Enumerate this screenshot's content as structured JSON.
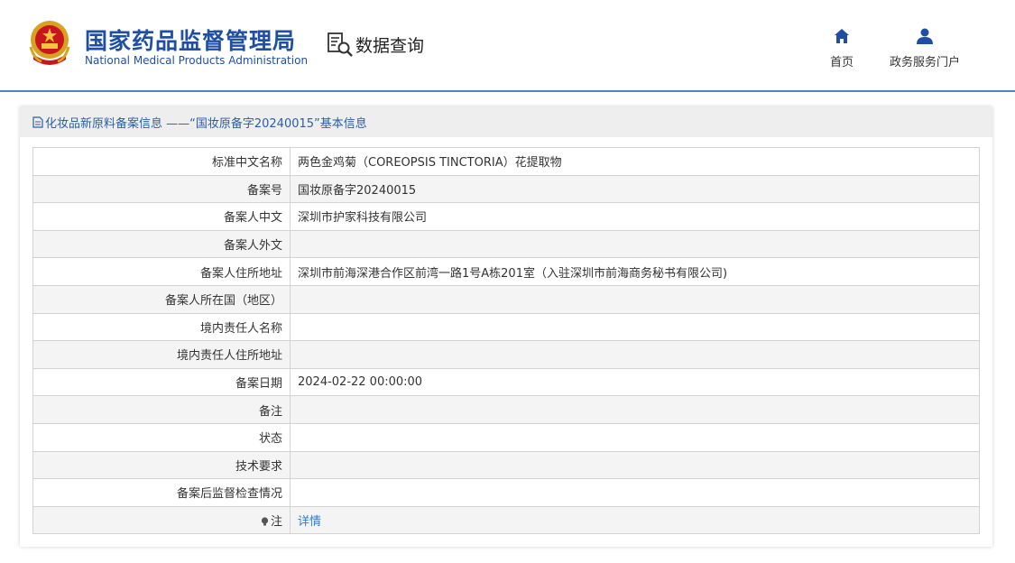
{
  "header": {
    "org_cn": "国家药品监督管理局",
    "org_en": "National Medical Products Administration",
    "data_query": "数据查询",
    "nav": [
      {
        "label": "首页",
        "icon": "home-icon"
      },
      {
        "label": "政务服务门户",
        "icon": "user-icon"
      }
    ]
  },
  "colors": {
    "brand": "#1f4fa3",
    "accent_line": "#4a86c6",
    "link": "#2b7bd6"
  },
  "panel": {
    "title": "化妆品新原料备案信息 ——“国妆原备字20240015”基本信息",
    "rows": [
      {
        "label": "标准中文名称",
        "value": "两色金鸡菊（COREOPSIS TINCTORIA）花提取物"
      },
      {
        "label": "备案号",
        "value": "国妆原备字20240015"
      },
      {
        "label": "备案人中文",
        "value": "深圳市护家科技有限公司"
      },
      {
        "label": "备案人外文",
        "value": ""
      },
      {
        "label": "备案人住所地址",
        "value": "深圳市前海深港合作区前湾一路1号A栋201室（入驻深圳市前海商务秘书有限公司)"
      },
      {
        "label": "备案人所在国（地区）",
        "value": ""
      },
      {
        "label": "境内责任人名称",
        "value": ""
      },
      {
        "label": "境内责任人住所地址",
        "value": ""
      },
      {
        "label": "备案日期",
        "value": "2024-02-22 00:00:00"
      },
      {
        "label": "备注",
        "value": ""
      },
      {
        "label": "状态",
        "value": ""
      },
      {
        "label": "技术要求",
        "value": ""
      },
      {
        "label": "备案后监督检查情况",
        "value": ""
      }
    ],
    "note_row": {
      "label": "注",
      "link": "详情"
    }
  }
}
